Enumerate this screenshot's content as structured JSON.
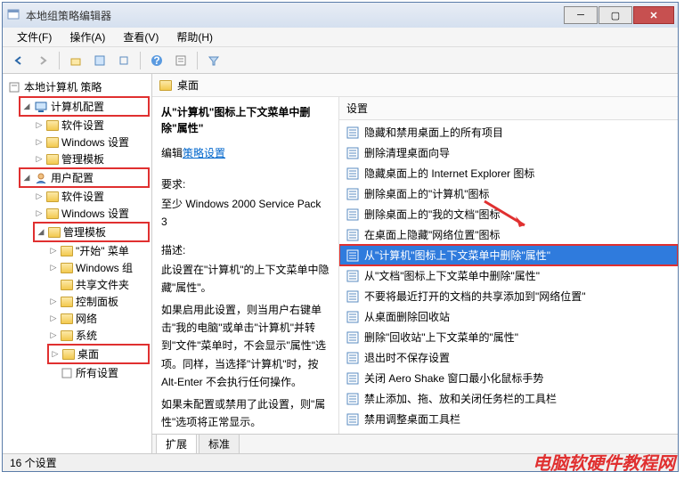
{
  "window": {
    "title": "本地组策略编辑器"
  },
  "menus": {
    "file": "文件(F)",
    "action": "操作(A)",
    "view": "查看(V)",
    "help": "帮助(H)"
  },
  "tree": {
    "root": "本地计算机 策略",
    "computer_config": "计算机配置",
    "cc_software": "软件设置",
    "cc_windows": "Windows 设置",
    "cc_admin": "管理模板",
    "user_config": "用户配置",
    "uc_software": "软件设置",
    "uc_windows": "Windows 设置",
    "uc_admin": "管理模板",
    "start_menu": "\"开始\" 菜单",
    "windows_comp": "Windows 组",
    "shared_folders": "共享文件夹",
    "control_panel": "控制面板",
    "network": "网络",
    "system": "系统",
    "desktop": "桌面",
    "all_settings": "所有设置"
  },
  "right": {
    "header": "桌面",
    "setting_header": "设置",
    "desc_title": "从\"计算机\"图标上下文菜单中删除\"属性\"",
    "edit_prefix": "编辑",
    "edit_link": "策略设置",
    "req_label": "要求:",
    "req_text": "至少 Windows 2000 Service Pack 3",
    "desc_label": "描述:",
    "desc_p1": "此设置在\"计算机\"的上下文菜单中隐藏\"属性\"。",
    "desc_p2": "如果启用此设置，则当用户右键单击\"我的电脑\"或单击\"计算机\"并转到\"文件\"菜单时，不会显示\"属性\"选项。同样，当选择\"计算机\"时，按 Alt-Enter 不会执行任何操作。",
    "desc_p3": "如果未配置或禁用了此设置，则\"属性\"选项将正常显示。"
  },
  "settings": [
    "隐藏和禁用桌面上的所有项目",
    "删除清理桌面向导",
    "隐藏桌面上的 Internet Explorer 图标",
    "删除桌面上的\"计算机\"图标",
    "删除桌面上的\"我的文档\"图标",
    "在桌面上隐藏\"网络位置\"图标",
    "从\"计算机\"图标上下文菜单中删除\"属性\"",
    "从\"文档\"图标上下文菜单中删除\"属性\"",
    "不要将最近打开的文档的共享添加到\"网络位置\"",
    "从桌面删除回收站",
    "删除\"回收站\"上下文菜单的\"属性\"",
    "退出时不保存设置",
    "关闭 Aero Shake 窗口最小化鼠标手势",
    "禁止添加、拖、放和关闭任务栏的工具栏",
    "禁用调整桌面工具栏"
  ],
  "selected_index": 6,
  "tabs": {
    "extended": "扩展",
    "standard": "标准"
  },
  "status": "16 个设置",
  "watermark": "电脑软硬件教程网"
}
